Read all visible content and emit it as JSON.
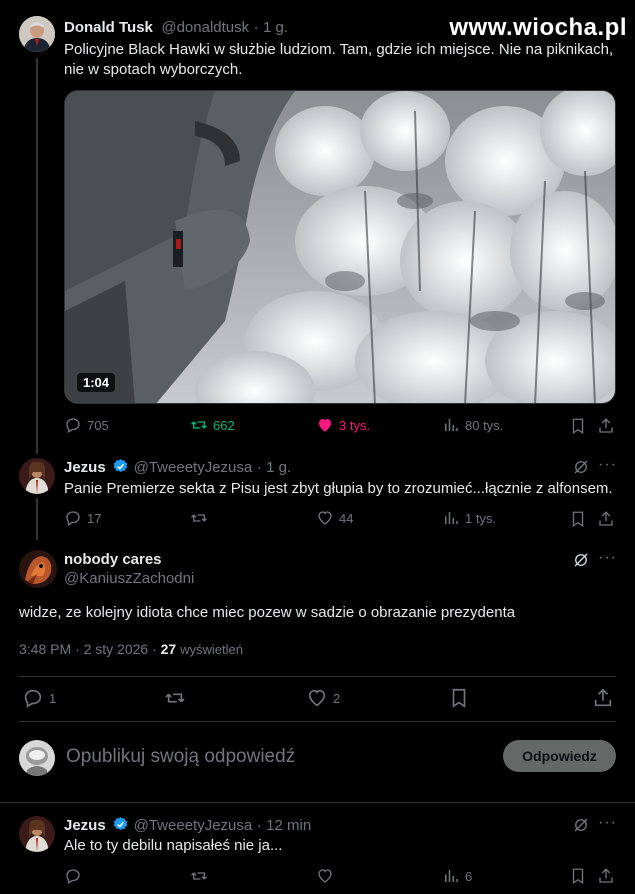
{
  "watermark": "www.wiocha.pl",
  "tweet1": {
    "name": "Donald Tusk",
    "handle": "@donaldtusk",
    "sep": "·",
    "time": "1 g.",
    "text_line1": "Policyjne Black Hawki w służbie ludziom. Tam, gdzie ich miejsce. Nie na piknikach,",
    "text_line2": "nie w spotach wyborczych.",
    "video_duration": "1:04",
    "replies": "705",
    "retweets": "662",
    "likes": "3 tys.",
    "views": "80 tys.",
    "colors": {
      "retweet": "#00ba7c",
      "like": "#f91880"
    }
  },
  "tweet2": {
    "name": "Jezus",
    "handle": "@TweeetyJezusa",
    "sep": "·",
    "time": "1 g.",
    "text": "Panie Premierze sekta z Pisu jest zbyt głupia by to zrozumieć...łącznie z alfonsem.",
    "replies": "17",
    "retweets": "",
    "likes": "44",
    "views": "1 tys."
  },
  "main": {
    "name": "nobody cares",
    "handle": "@KaniuszZachodni",
    "text": "widze, ze kolejny idiota chce miec pozew w sadzie o obrazanie prezydenta",
    "timestamp": "3:48 PM · 2 sty 2026 ·",
    "views_count": "27",
    "views_label": "wyświetleń",
    "replies": "1",
    "likes": "2"
  },
  "composer": {
    "placeholder": "Opublikuj swoją odpowiedź",
    "button": "Odpowiedz"
  },
  "tweet3": {
    "name": "Jezus",
    "handle": "@TweeetyJezusa",
    "sep": "·",
    "time": "12 min",
    "text": "Ale to ty debilu napisałeś nie ja...",
    "views": "6"
  },
  "accent": "#1d9bf0"
}
